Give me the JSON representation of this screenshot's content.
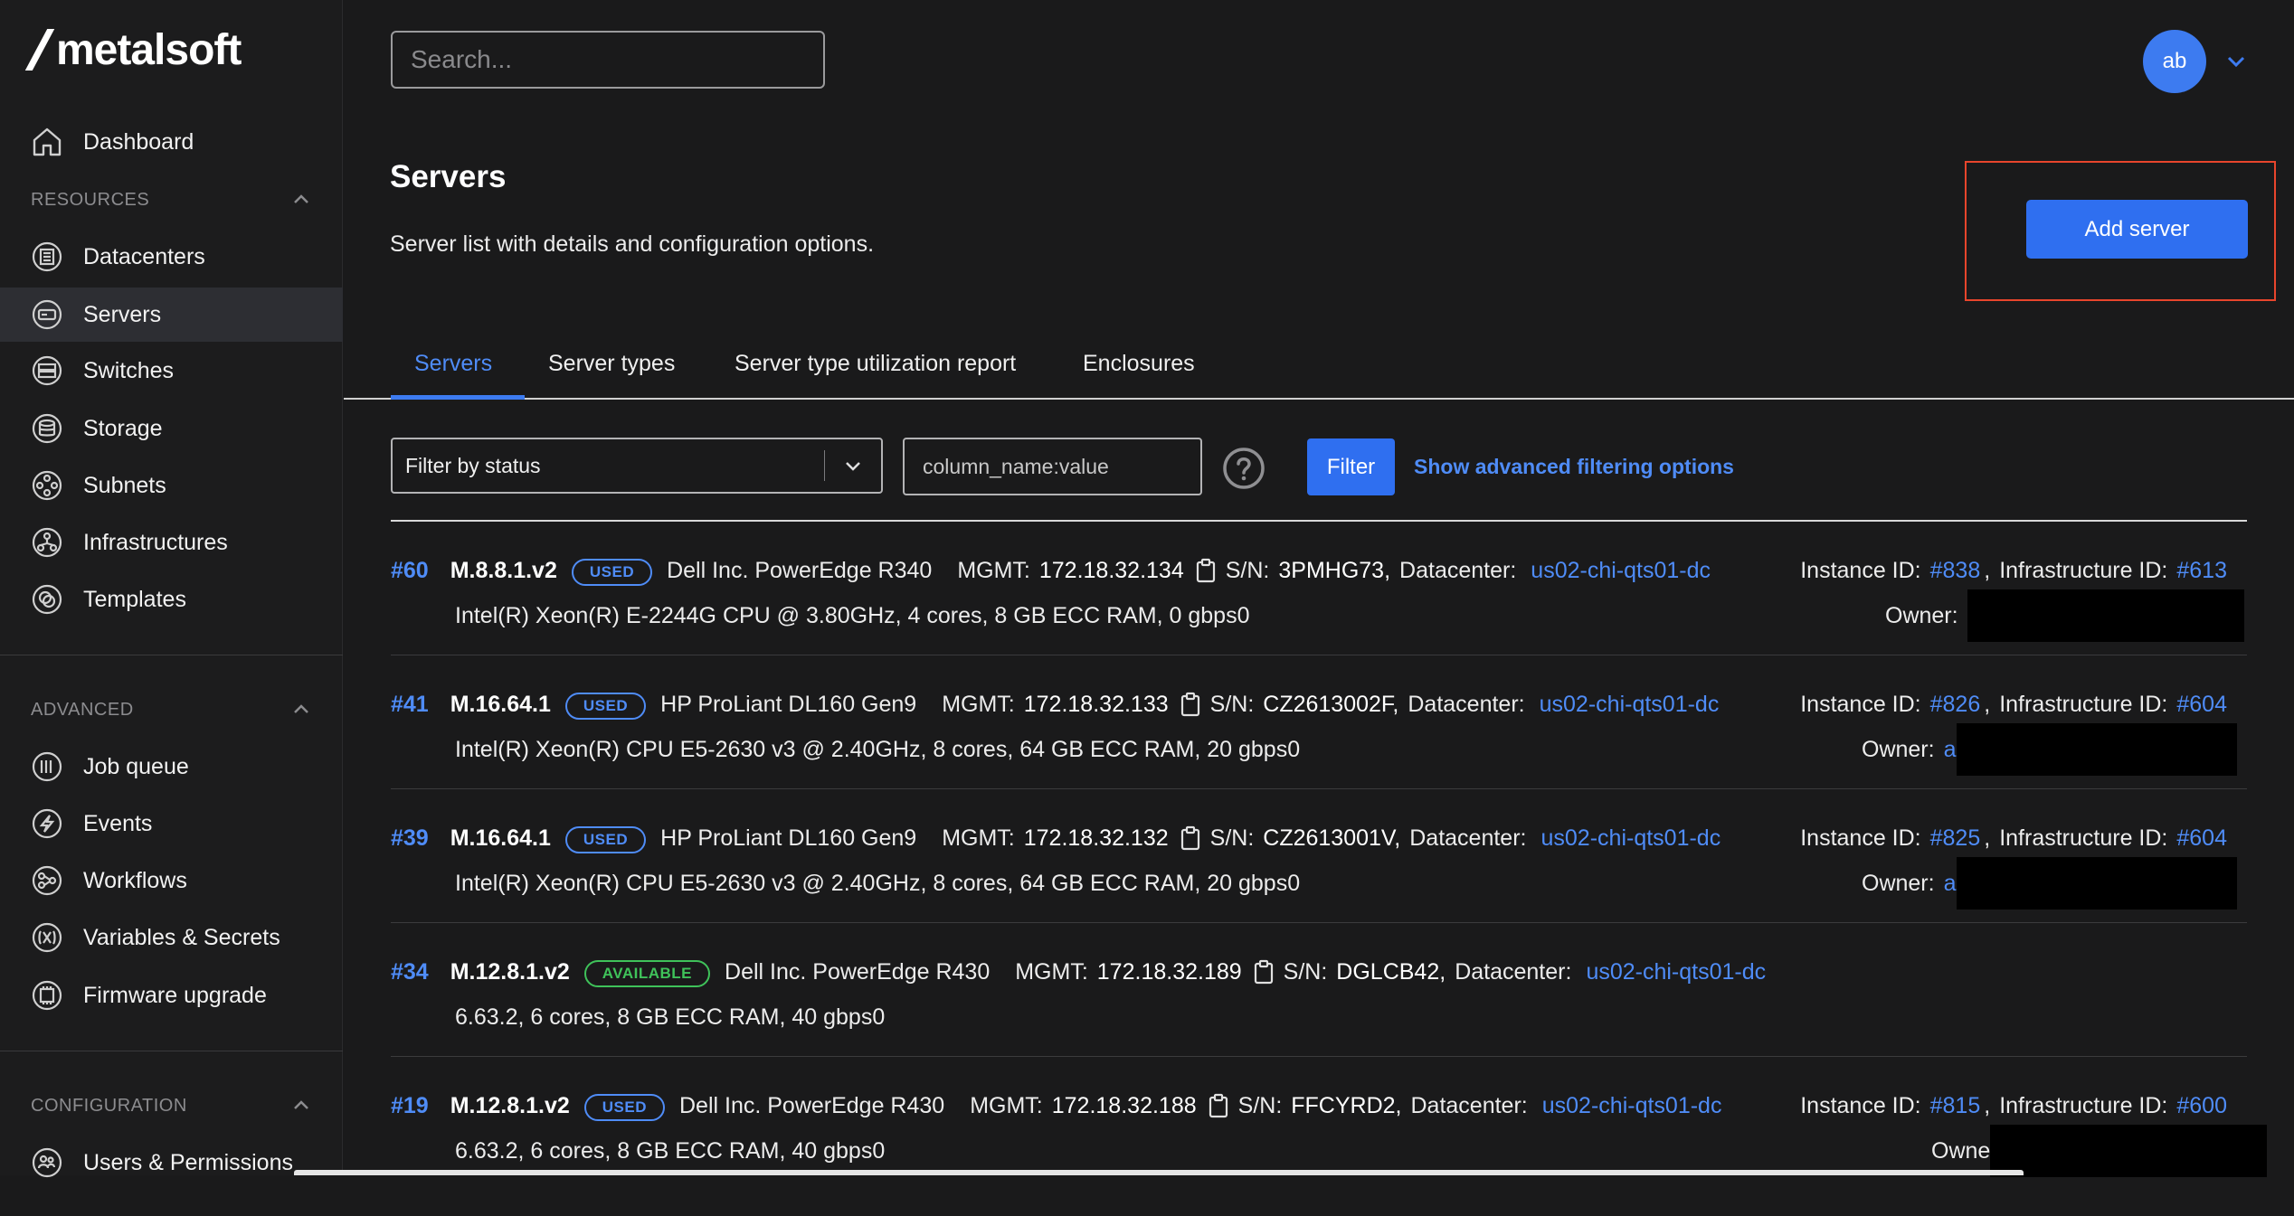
{
  "app": {
    "logo_text": "metalsoft"
  },
  "search": {
    "placeholder": "Search..."
  },
  "user": {
    "initials": "ab"
  },
  "sidebar": {
    "dashboard": "Dashboard",
    "sections": [
      {
        "title": "RESOURCES",
        "items": [
          "Datacenters",
          "Servers",
          "Switches",
          "Storage",
          "Subnets",
          "Infrastructures",
          "Templates"
        ]
      },
      {
        "title": "ADVANCED",
        "items": [
          "Job queue",
          "Events",
          "Workflows",
          "Variables & Secrets",
          "Firmware upgrade"
        ]
      },
      {
        "title": "CONFIGURATION",
        "items": [
          "Users & Permissions"
        ]
      }
    ],
    "active_item": "Servers"
  },
  "page": {
    "title": "Servers",
    "subtitle": "Server list with details and configuration options.",
    "add_button": "Add server"
  },
  "tabs": [
    "Servers",
    "Server types",
    "Server type utilization report",
    "Enclosures"
  ],
  "active_tab": "Servers",
  "filters": {
    "status_placeholder": "Filter by status",
    "query_placeholder": "column_name:value",
    "filter_button": "Filter",
    "advanced_link": "Show advanced filtering options"
  },
  "labels": {
    "mgmt": "MGMT:",
    "sn": "S/N:",
    "datacenter": "Datacenter:",
    "instance_id": "Instance ID:",
    "infrastructure_id": "Infrastructure ID:",
    "owner": "Owner:",
    "owner_short": "Owne"
  },
  "servers": [
    {
      "id": "#60",
      "type": "M.8.8.1.v2",
      "status": "USED",
      "vendor": "Dell Inc. PowerEdge R340",
      "mgmt": "172.18.32.134",
      "sn": "3PMHG73,",
      "datacenter": "us02-chi-qts01-dc",
      "instance_id": "#838",
      "infrastructure_id": "#613",
      "specs": "Intel(R) Xeon(R) E-2244G CPU @ 3.80GHz, 4 cores, 8 GB ECC RAM, 0 gbps0",
      "owner_visible": ""
    },
    {
      "id": "#41",
      "type": "M.16.64.1",
      "status": "USED",
      "vendor": "HP ProLiant DL160 Gen9",
      "mgmt": "172.18.32.133",
      "sn": "CZ2613002F,",
      "datacenter": "us02-chi-qts01-dc",
      "instance_id": "#826",
      "infrastructure_id": "#604",
      "specs": "Intel(R) Xeon(R) CPU E5-2630 v3 @ 2.40GHz, 8 cores, 64 GB ECC RAM, 20 gbps0",
      "owner_visible": "a"
    },
    {
      "id": "#39",
      "type": "M.16.64.1",
      "status": "USED",
      "vendor": "HP ProLiant DL160 Gen9",
      "mgmt": "172.18.32.132",
      "sn": "CZ2613001V,",
      "datacenter": "us02-chi-qts01-dc",
      "instance_id": "#825",
      "infrastructure_id": "#604",
      "specs": "Intel(R) Xeon(R) CPU E5-2630 v3 @ 2.40GHz, 8 cores, 64 GB ECC RAM, 20 gbps0",
      "owner_visible": "a"
    },
    {
      "id": "#34",
      "type": "M.12.8.1.v2",
      "status": "AVAILABLE",
      "vendor": "Dell Inc. PowerEdge R430",
      "mgmt": "172.18.32.189",
      "sn": "DGLCB42,",
      "datacenter": "us02-chi-qts01-dc",
      "specs": "6.63.2, 6 cores, 8 GB ECC RAM, 40 gbps0"
    },
    {
      "id": "#19",
      "type": "M.12.8.1.v2",
      "status": "USED",
      "vendor": "Dell Inc. PowerEdge R430",
      "mgmt": "172.18.32.188",
      "sn": "FFCYRD2,",
      "datacenter": "us02-chi-qts01-dc",
      "instance_id": "#815",
      "infrastructure_id": "#600",
      "specs": "6.63.2, 6 cores, 8 GB ECC RAM, 40 gbps0"
    }
  ],
  "colors": {
    "accent": "#2f6ff0",
    "link": "#4f8cf7",
    "available": "#3fc25a",
    "highlight": "#e8452c",
    "bg": "#1a1a1b"
  }
}
